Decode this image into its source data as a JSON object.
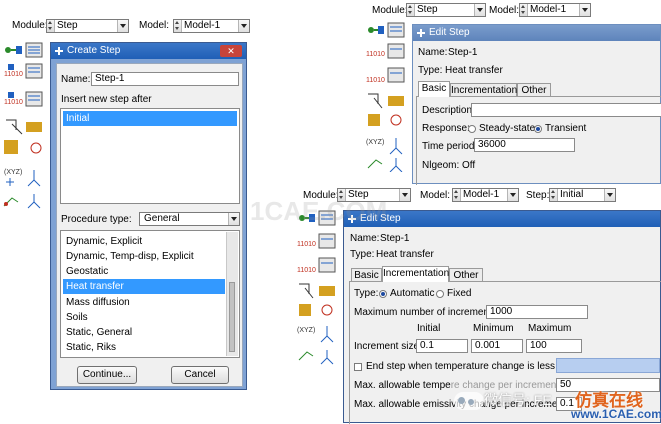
{
  "left_panel": {
    "module_label": "Module:",
    "module_value": "Step",
    "model_label": "Model:",
    "model_value": "Model-1"
  },
  "create_step": {
    "title": "Create Step",
    "close_glyph": "✕",
    "name_label": "Name:",
    "name_value": "Step-1",
    "insert_after_label": "Insert new step after",
    "insert_after_items": [
      "Initial"
    ],
    "procedure_label": "Procedure type:",
    "procedure_value": "General",
    "procedures": [
      "Dynamic, Explicit",
      "Dynamic, Temp-disp, Explicit",
      "Geostatic",
      "Heat transfer",
      "Mass diffusion",
      "Soils",
      "Static, General",
      "Static, Riks"
    ],
    "selected_procedure": "Heat transfer",
    "continue_label": "Continue...",
    "cancel_label": "Cancel"
  },
  "top_right": {
    "module_label": "Module:",
    "module_value": "Step",
    "model_label": "Model:",
    "model_value": "Model-1"
  },
  "edit_step_basic": {
    "title": "Edit Step",
    "name_label": "Name:",
    "name_value": "Step-1",
    "type_label": "Type:",
    "type_value": "Heat transfer",
    "tabs": [
      "Basic",
      "Incrementation",
      "Other"
    ],
    "description_label": "Description:",
    "description_value": "",
    "response_label": "Response:",
    "steady_label": "Steady-state",
    "transient_label": "Transient",
    "time_period_label": "Time period:",
    "time_period_value": "36000",
    "nlgeom_label": "Nlgeom:",
    "nlgeom_value": "Off"
  },
  "bottom_right": {
    "module_label": "Module:",
    "module_value": "Step",
    "model_label": "Model:",
    "model_value": "Model-1",
    "step_label": "Step:",
    "step_value": "Initial"
  },
  "edit_step_incr": {
    "title": "Edit Step",
    "name_label": "Name:",
    "name_value": "Step-1",
    "type_label": "Type:",
    "type_value": "Heat transfer",
    "tabs": [
      "Basic",
      "Incrementation",
      "Other"
    ],
    "type_row_label": "Type:",
    "automatic_label": "Automatic",
    "fixed_label": "Fixed",
    "max_incr_label": "Maximum number of increments:",
    "max_incr_value": "1000",
    "col_initial": "Initial",
    "col_minimum": "Minimum",
    "col_maximum": "Maximum",
    "incr_size_label": "Increment size:",
    "incr_initial": "0.1",
    "incr_minimum": "0.001",
    "incr_maximum": "100",
    "end_step_label": "End step when temperature change is less than:",
    "max_temp_label": "Max. allowable tempe",
    "max_temp_label_tail": "re change per increment:",
    "max_temp_value": "50",
    "max_emiss_label": "Max. allowable emissivity change per increment:",
    "max_emiss_value": "0.1"
  },
  "watermark": {
    "wechat_text": "微信号: FE",
    "brand_text": "仿真在线",
    "site_text": "www.1CAE.com",
    "center_text": "1CAE.COM"
  },
  "colors": {
    "title_active": "#1f5fb6",
    "title_inactive": "#6d8fbf",
    "selection": "#3399ff",
    "dialog_bg": "#f0f0f0"
  }
}
